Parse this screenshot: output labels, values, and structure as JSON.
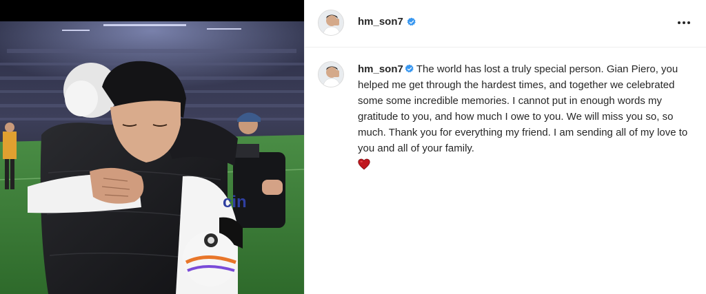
{
  "post": {
    "username": "hm_son7",
    "verified": true,
    "more_options_icon": "more-horizontal-icon",
    "caption": {
      "username": "hm_son7",
      "text": "The world has lost a truly special person. Gian Piero, you helped me get through the hardest times, and together we celebrated some some incredible memories. I cannot put in enough words my gratitude to you, and how much I owe to you. We will miss you so, so much. Thank you for everything my friend. I am sending all of my love to you and all of your family.",
      "emoji": "red-heart-icon"
    },
    "photo": {
      "jersey_sponsor_text": "cin"
    },
    "colors": {
      "verified_badge": "#3897f0",
      "heart": "#c0181f",
      "pitch_green": "#3c7a37",
      "jacket_black": "#1a1a1c"
    }
  }
}
